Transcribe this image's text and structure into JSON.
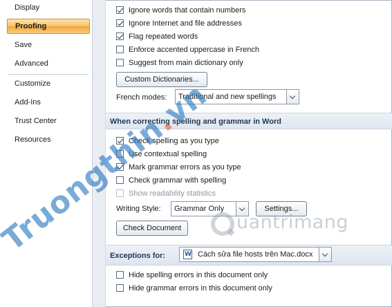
{
  "sidebar": {
    "items": [
      {
        "label": "Display"
      },
      {
        "label": "Proofing"
      },
      {
        "label": "Save"
      },
      {
        "label": "Advanced"
      },
      {
        "label": "Customize"
      },
      {
        "label": "Add-Ins"
      },
      {
        "label": "Trust Center"
      },
      {
        "label": "Resources"
      }
    ],
    "selected": "Proofing"
  },
  "office_options": {
    "ignore_numbers": {
      "label": "Ignore words that contain numbers",
      "checked": true
    },
    "ignore_internet": {
      "label": "Ignore Internet and file addresses",
      "checked": true
    },
    "flag_repeated": {
      "label": "Flag repeated words",
      "checked": true
    },
    "enforce_accented": {
      "label": "Enforce accented uppercase in French",
      "checked": false
    },
    "suggest_main": {
      "label": "Suggest from main dictionary only",
      "checked": false
    },
    "custom_dictionaries_label": "Custom Dictionaries...",
    "french_modes_label": "French modes:",
    "french_modes_value": "Traditional and new spellings"
  },
  "word_section": {
    "title": "When correcting spelling and grammar in Word",
    "check_spelling": {
      "label": "Check spelling as you type",
      "checked": true
    },
    "contextual_spelling": {
      "label": "Use contextual spelling",
      "checked": false
    },
    "mark_grammar": {
      "label": "Mark grammar errors as you type",
      "checked": true
    },
    "check_grammar": {
      "label": "Check grammar with spelling",
      "checked": false
    },
    "readability": {
      "label": "Show readability statistics",
      "checked": false,
      "disabled": true
    },
    "writing_style_label": "Writing Style:",
    "writing_style_value": "Grammar Only",
    "settings_label": "Settings...",
    "check_document_label": "Check Document"
  },
  "exceptions": {
    "label": "Exceptions for:",
    "document": "Cách sửa file hosts trên Mac.docx",
    "hide_spelling": {
      "label": "Hide spelling errors in this document only",
      "checked": false
    },
    "hide_grammar": {
      "label": "Hide grammar errors in this document only",
      "checked": false
    }
  },
  "watermarks": {
    "main": "Truongthin",
    "dot": ".",
    "tld": "vn",
    "logo_text": "uantrimang"
  },
  "colors": {
    "selected_accent": "#f9c46b",
    "section_header_bg": "#dde5ef",
    "watermark_blue": "#2878be"
  }
}
